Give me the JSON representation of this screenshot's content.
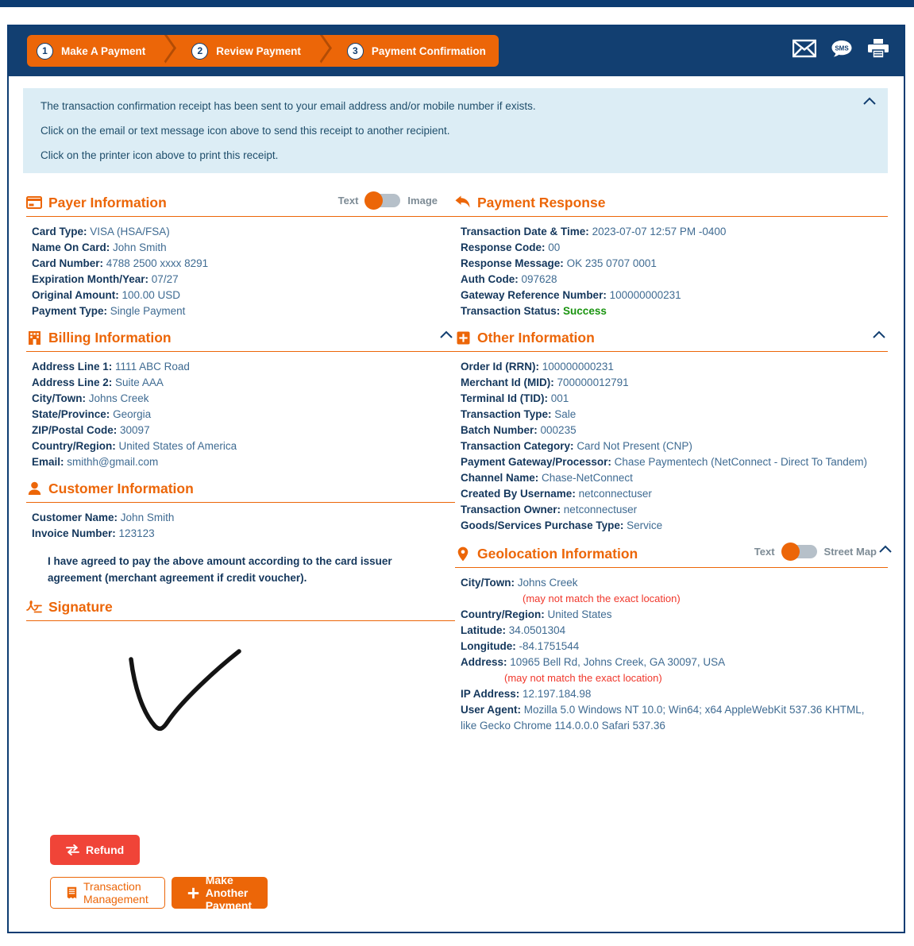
{
  "header": {
    "steps": [
      {
        "num": "1",
        "label": "Make A Payment"
      },
      {
        "num": "2",
        "label": "Review Payment"
      },
      {
        "num": "3",
        "label": "Payment Confirmation"
      }
    ],
    "icons": [
      {
        "name": "email-icon",
        "label": "Email"
      },
      {
        "name": "sms-icon",
        "label": "SMS"
      },
      {
        "name": "printer-icon",
        "label": "Print"
      }
    ],
    "accent_color": "#ec6608",
    "header_color": "#123f71"
  },
  "banner": {
    "line1": "The transaction confirmation receipt has been sent to your email address and/or mobile number if exists.",
    "line2": "Click on the email or text message icon above to send this receipt to another recipient.",
    "line3": "Click on the printer icon above to print this receipt.",
    "background": "#dcedf5"
  },
  "payer_information": {
    "title": "Payer Information",
    "toggle": {
      "left_label": "Text",
      "right_label": "Image",
      "selected": "Text"
    },
    "fields": [
      {
        "label": "Card Type:",
        "value": "VISA (HSA/FSA)"
      },
      {
        "label": "Name On Card:",
        "value": "John Smith"
      },
      {
        "label": "Card Number:",
        "value": "4788 2500 xxxx 8291"
      },
      {
        "label": "Expiration Month/Year:",
        "value": "07/27"
      },
      {
        "label": "Original Amount:",
        "value": "100.00 USD"
      },
      {
        "label": "Payment Type:",
        "value": "Single Payment"
      }
    ]
  },
  "billing_information": {
    "title": "Billing Information",
    "fields": [
      {
        "label": "Address Line 1:",
        "value": "1111 ABC Road"
      },
      {
        "label": "Address Line 2:",
        "value": "Suite AAA"
      },
      {
        "label": "City/Town:",
        "value": "Johns Creek"
      },
      {
        "label": "State/Province:",
        "value": "Georgia"
      },
      {
        "label": "ZIP/Postal Code:",
        "value": "30097"
      },
      {
        "label": "Country/Region:",
        "value": "United States of America"
      },
      {
        "label": "Email:",
        "value": "smithh@gmail.com"
      }
    ]
  },
  "customer_information": {
    "title": "Customer Information",
    "fields": [
      {
        "label": "Customer Name:",
        "value": "John Smith"
      },
      {
        "label": "Invoice Number:",
        "value": "123123"
      }
    ],
    "agreement": "I have agreed to pay the above amount according to the card issuer agreement (merchant agreement if credit voucher)."
  },
  "signature": {
    "title": "Signature"
  },
  "payment_response": {
    "title": "Payment Response",
    "fields": [
      {
        "label": "Transaction Date & Time:",
        "value": "2023-07-07 12:57 PM -0400"
      },
      {
        "label": "Response Code:",
        "value": "00"
      },
      {
        "label": "Response Message:",
        "value": "OK 235 0707 0001"
      },
      {
        "label": "Auth Code:",
        "value": "097628"
      },
      {
        "label": "Gateway Reference Number:",
        "value": "100000000231"
      }
    ],
    "status_label": "Transaction Status:",
    "status_value": "Success",
    "status_color": "#1a9410"
  },
  "other_information": {
    "title": "Other Information",
    "fields": [
      {
        "label": "Order Id (RRN):",
        "value": "100000000231"
      },
      {
        "label": "Merchant Id (MID):",
        "value": "700000012791"
      },
      {
        "label": "Terminal Id (TID):",
        "value": "001"
      },
      {
        "label": "Transaction Type:",
        "value": "Sale"
      },
      {
        "label": "Batch Number:",
        "value": "000235"
      },
      {
        "label": "Transaction Category:",
        "value": "Card Not Present (CNP)"
      },
      {
        "label": "Payment Gateway/Processor:",
        "value": "Chase Paymentech (NetConnect - Direct To Tandem)"
      },
      {
        "label": "Channel Name:",
        "value": "Chase-NetConnect"
      },
      {
        "label": "Created By Username:",
        "value": "netconnectuser"
      },
      {
        "label": "Transaction Owner:",
        "value": "netconnectuser"
      },
      {
        "label": "Goods/Services Purchase Type:",
        "value": "Service"
      }
    ]
  },
  "geolocation_information": {
    "title": "Geolocation Information",
    "toggle": {
      "left_label": "Text",
      "right_label": "Street Map",
      "selected": "Text"
    },
    "city_label": "City/Town:",
    "city_value": "Johns Creek",
    "city_note": "(may not match the exact location)",
    "country_label": "Country/Region:",
    "country_value": "United States",
    "latitude_label": "Latitude:",
    "latitude_value": "34.0501304",
    "longitude_label": "Longitude:",
    "longitude_value": "-84.1751544",
    "address_label": "Address:",
    "address_value": "10965 Bell Rd, Johns Creek, GA 30097, USA",
    "address_note": "(may not match the exact location)",
    "ip_label": "IP Address:",
    "ip_value": "12.197.184.98",
    "ua_label": "User Agent:",
    "ua_value": "Mozilla 5.0 Windows NT 10.0; Win64; x64 AppleWebKit 537.36 KHTML, like Gecko Chrome 114.0.0.0 Safari 537.36",
    "note_color": "#f0372b"
  },
  "buttons": {
    "refund": "Refund",
    "transaction_management": "Transaction Management",
    "make_another_payment": "Make Another Payment",
    "refund_color": "#f04438",
    "primary_color": "#ec6608"
  }
}
